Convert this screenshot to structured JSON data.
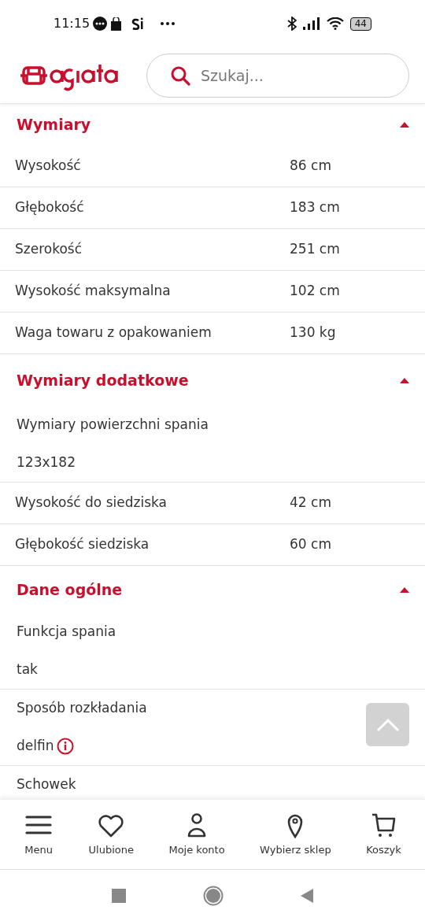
{
  "status_bar": {
    "time": "11:15",
    "battery": "44"
  },
  "search": {
    "placeholder": "Szukaj..."
  },
  "sections": [
    {
      "title": "Wymiary",
      "expanded": true,
      "rows": [
        {
          "kind": "pair",
          "label": "Wysokość",
          "value": "86 cm"
        },
        {
          "kind": "pair",
          "label": "Głębokość",
          "value": "183 cm"
        },
        {
          "kind": "pair",
          "label": "Szerokość",
          "value": "251 cm"
        },
        {
          "kind": "pair",
          "label": "Wysokość maksymalna",
          "value": "102 cm"
        },
        {
          "kind": "pair",
          "label": "Waga towaru z opakowaniem",
          "value": "130 kg"
        }
      ]
    },
    {
      "title": "Wymiary dodatkowe",
      "expanded": true,
      "rows": [
        {
          "kind": "stacked",
          "label": "Wymiary powierzchni spania",
          "value": "123x182"
        },
        {
          "kind": "pair",
          "label": "Wysokość do siedziska",
          "value": "42 cm"
        },
        {
          "kind": "pair",
          "label": "Głębokość siedziska",
          "value": "60 cm"
        }
      ]
    },
    {
      "title": "Dane ogólne",
      "expanded": true,
      "rows": [
        {
          "kind": "stacked",
          "label": "Funkcja spania",
          "value": "tak"
        },
        {
          "kind": "stacked",
          "label": "Sposób rozkładania",
          "value": "delfin",
          "info": true
        },
        {
          "kind": "stacked",
          "label": "Schowek"
        }
      ]
    }
  ],
  "bottom_nav": [
    {
      "kind": "menu",
      "label": "Menu"
    },
    {
      "kind": "heart",
      "label": "Ulubione"
    },
    {
      "kind": "person",
      "label": "Moje konto"
    },
    {
      "kind": "pin",
      "label": "Wybierz sklep"
    },
    {
      "kind": "cart",
      "label": "Koszyk"
    }
  ]
}
